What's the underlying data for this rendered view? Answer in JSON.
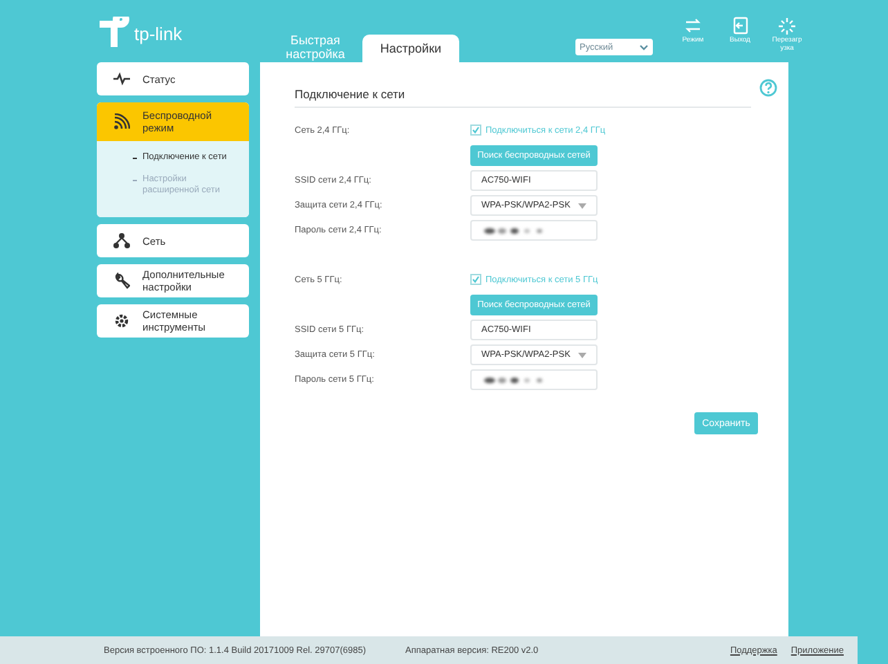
{
  "header": {
    "logo": "tp-link",
    "tabs": [
      {
        "label": "Быстрая настройка",
        "selected": false
      },
      {
        "label": "Настройки",
        "selected": true
      }
    ],
    "language": {
      "value": "Русский"
    },
    "actions": [
      {
        "kind": "mode",
        "label": "Режим"
      },
      {
        "kind": "exit",
        "label": "Выход"
      },
      {
        "kind": "reboot",
        "label": "Перезагрузка"
      }
    ]
  },
  "sidebar": {
    "items": [
      {
        "label": "Статус",
        "selected": false
      },
      {
        "label": "Беспроводной режим",
        "selected": true,
        "children": [
          {
            "label": "Подключение к сети",
            "selected": true
          },
          {
            "label": "Настройки расширенной сети",
            "selected": false
          }
        ]
      },
      {
        "label": "Сеть",
        "selected": false
      },
      {
        "label": "Дополнительные настройки",
        "selected": false
      },
      {
        "label": "Системные инструменты",
        "selected": false
      }
    ]
  },
  "main": {
    "title": "Подключение к сети",
    "sections": [
      {
        "label": "Сеть 2,4 ГГц:",
        "connect": {
          "label": "Подключиться к сети 2,4 ГГц",
          "checked": true
        },
        "scan_button": "Поиск беспроводных сетей",
        "fields": [
          {
            "kind": "text",
            "label": "SSID сети 2,4 ГГц:",
            "value": "AC750-WIFI"
          },
          {
            "kind": "select",
            "label": "Защита сети 2,4 ГГц:",
            "value": "WPA-PSK/WPA2-PSK"
          },
          {
            "kind": "password",
            "label": "Пароль сети 2,4 ГГц:"
          }
        ]
      },
      {
        "label": "Сеть 5 ГГц:",
        "connect": {
          "label": "Подключиться к сети 5 ГГц",
          "checked": true
        },
        "scan_button": "Поиск беспроводных сетей",
        "fields": [
          {
            "kind": "text",
            "label": "SSID сети 5 ГГц:",
            "value": "AC750-WIFI"
          },
          {
            "kind": "select",
            "label": "Защита сети 5 ГГц:",
            "value": "WPA-PSK/WPA2-PSK"
          },
          {
            "kind": "password",
            "label": "Пароль сети 5 ГГц:"
          }
        ]
      }
    ],
    "save_button": "Сохранить"
  },
  "footer": {
    "firmware": "Версия встроенного ПО: 1.1.4 Build 20171009 Rel. 29707(6985)",
    "hardware": "Аппаратная версия: RE200 v2.0",
    "links": [
      "Поддержка",
      "Приложение"
    ]
  }
}
